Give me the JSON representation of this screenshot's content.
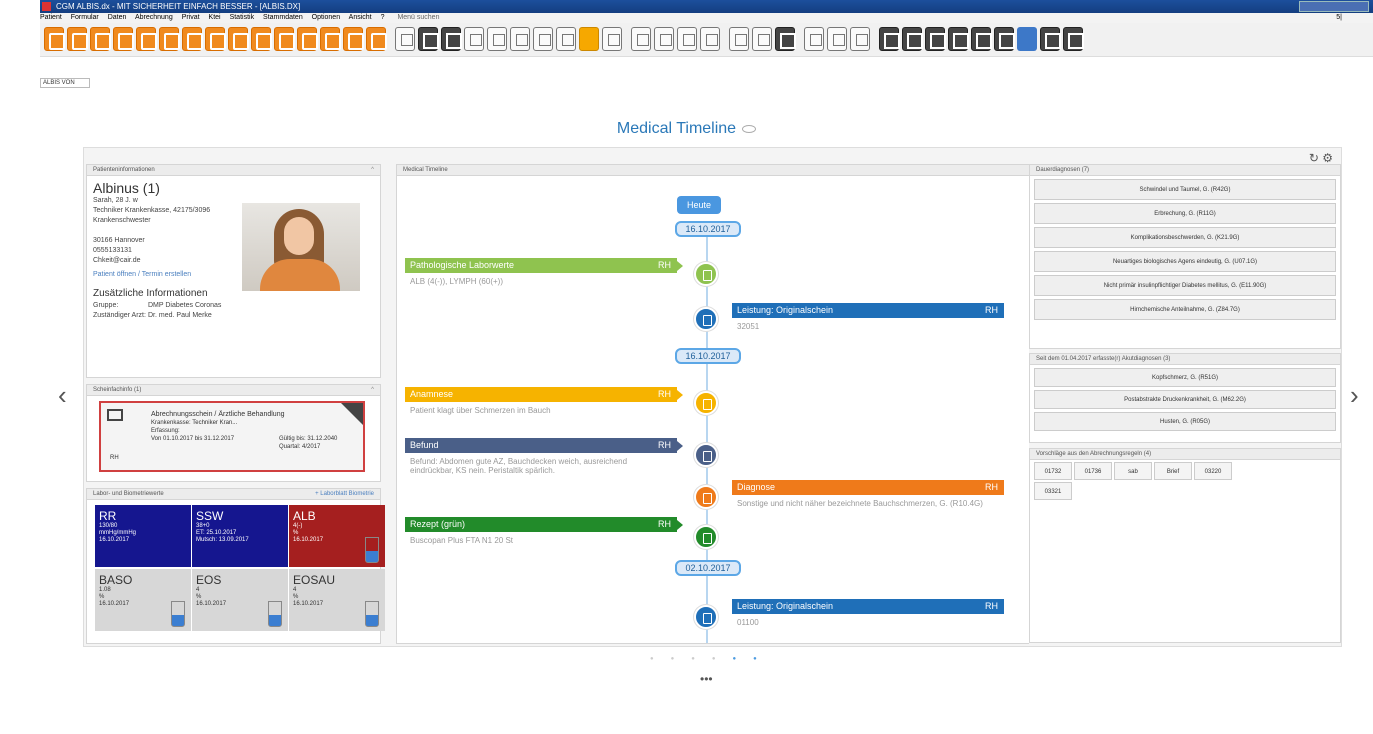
{
  "window": {
    "title": "CGM ALBIS.dx - MIT SICHERHEIT EINFACH BESSER - [ALBIS.DX]"
  },
  "menu": [
    "Patient",
    "Formular",
    "Daten",
    "Abrechnung",
    "Privat",
    "Ktei",
    "Statistik",
    "Stammdaten",
    "Optionen",
    "Ansicht",
    "?"
  ],
  "menu_search": "Menü suchen",
  "menu_corner": "5|",
  "tab": {
    "label": "ALBIS VON"
  },
  "page_title": "Medical Timeline",
  "patient": {
    "header": "Patienteninformationen",
    "name": "Albinus (1)",
    "lines": [
      "Sarah, 28 J. w",
      "Techniker Krankenkasse, 42175/3096",
      "Krankenschwester",
      "",
      "30166 Hannover",
      "0555133131",
      "Chkeit@cair.de"
    ],
    "link": "Patient öffnen / Termin erstellen",
    "add_title": "Zusätzliche Informationen",
    "add_lines": [
      {
        "k": "Gruppe:",
        "v": "DMP Diabetes Coronas"
      },
      {
        "k": "Zuständiger Arzt:",
        "v": "Dr. med. Paul Merke"
      }
    ]
  },
  "notes": {
    "header": "Scheinfachinfo (1)",
    "card_lines": [
      "Abrechnungsschein / Ärztliche Behandlung",
      "Krankenkasse: Techniker Kran...",
      "Erfassung:",
      "Von 01.10.2017 bis 31.12.2017"
    ],
    "card_right": [
      "Gültig bis: 31.12.2040",
      "Quartal: 4/2017"
    ],
    "initials": "RH"
  },
  "labs": {
    "header": "Labor- und Biometriewerte",
    "link": "+ Laborblatt  Biometrie",
    "tiles": [
      {
        "title": "RR",
        "value": "130/80",
        "unit": "mmHg/mmHg",
        "date": "16.10.2017",
        "color": "#15168f"
      },
      {
        "title": "SSW",
        "value": "38+0",
        "unit": "ET: 25.10.2017",
        "date": "Mutsch: 13.09.2017",
        "color": "#15168f"
      },
      {
        "title": "ALB",
        "value": "4(-)",
        "unit": "%",
        "date": "16.10.2017",
        "color": "#a51f1f"
      },
      {
        "title": "BASO",
        "value": "1.08",
        "unit": "%",
        "date": "16.10.2017",
        "color": "#d7d7d7"
      },
      {
        "title": "EOS",
        "value": "4",
        "unit": "%",
        "date": "16.10.2017",
        "color": "#d7d7d7"
      },
      {
        "title": "EOSAU",
        "value": "4",
        "unit": "%",
        "date": "16.10.2017",
        "color": "#d7d7d7"
      }
    ]
  },
  "timeline": {
    "header": "Medical Timeline",
    "heute": "Heute",
    "dates": [
      "16.10.2017",
      "16.10.2017",
      "02.10.2017"
    ],
    "events": [
      {
        "title": "Pathologische Laborwerte",
        "rh": "RH",
        "body": "ALB (4(-)), LYMPH (60(+))",
        "color": "#8fc34f"
      },
      {
        "title": "Leistung: Originalschein",
        "rh": "RH",
        "body": "32051",
        "color": "#1f6fb8"
      },
      {
        "title": "Anamnese",
        "rh": "RH",
        "body": "Patient klagt über Schmerzen im Bauch",
        "color": "#f6b300"
      },
      {
        "title": "Befund",
        "rh": "RH",
        "body": "Befund: Abdomen gute AZ, Bauchdecken weich, ausreichend eindrückbar, KS nein. Peristaltik spärlich.",
        "color": "#4a5f88"
      },
      {
        "title": "Diagnose",
        "rh": "RH",
        "body": "Sonstige und nicht näher bezeichnete Bauchschmerzen, G. (R10.4G)",
        "color": "#ef7a1a"
      },
      {
        "title": "Rezept (grün)",
        "rh": "RH",
        "body": "Buscopan Plus FTA N1 20 St",
        "color": "#228b2a"
      },
      {
        "title": "Leistung: Originalschein",
        "rh": "RH",
        "body": "01100",
        "color": "#1f6fb8"
      }
    ]
  },
  "side": {
    "dauer_header": "Dauerdiagnosen (7)",
    "dauer": [
      "Schwindel und Taumel, G. (R42G)",
      "Erbrechung, G. (R11G)",
      "Komplikationsbeschwerden, G. (K21.9G)",
      "Neuartiges biologisches Agens eindeutig, G. (U07.1G)",
      "Nicht primär insulinpflichtiger Diabetes mellitus, G. (E11.90G)",
      "Hirnchemische Anteilnahme, G. (Z84.7G)"
    ],
    "letzte_header": "Seit dem 01.04.2017 erfasste(r) Akutdiagnosen (3)",
    "letzte": [
      "Kopfschmerz, G. (R51G)",
      "Postabstrakte Druckenkrankheit, G. (M62.2G)",
      "Husten, G. (R05G)"
    ],
    "vorschlag_header": "Vorschläge aus den Abrechnungsregeln (4)",
    "vorschlag": [
      "01732",
      "01736",
      "sab",
      "Brief",
      "03220",
      "03321"
    ]
  },
  "pager": {
    "more": "•••"
  }
}
